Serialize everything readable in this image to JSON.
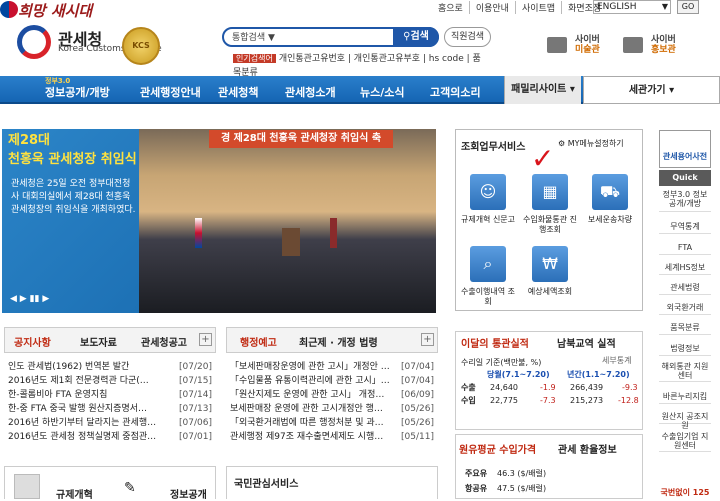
{
  "header": {
    "slogan": "희망 새시대",
    "brand_name": "관세청",
    "brand_sub": "Korea Customs Service",
    "badge": "KCS",
    "top_links": [
      "홈으로",
      "이용안내",
      "사이트맵",
      "화면조정"
    ],
    "language": "ENGLISH",
    "go": "GO",
    "search_scope": "통합검색",
    "search_button": "검색",
    "staff_search": "직원검색",
    "hot_keyword_tag": "인기검색어",
    "hot_keywords": "개인통관고유번호 | 개인통관고유부호 | hs code | 품목분류",
    "cyber1_top": "사이버",
    "cyber1_bottom": "미술관",
    "cyber2_top": "사이버",
    "cyber2_bottom": "홍보관"
  },
  "nav": {
    "gov30": "정부3.0",
    "items": [
      "정보공개/개방",
      "관세행정안내",
      "관세청책",
      "관세청소개",
      "뉴스/소식",
      "고객의소리"
    ],
    "family": "패밀리사이트",
    "sitegate": "세관가기"
  },
  "banner": {
    "title_line1": "제28대",
    "title_line2": "천홍욱 관세청장 취임식",
    "desc": "관세청은 25일 오전 정부대전청사 대회의실에서 제28대 천홍욱관세청장의 취임식을 개최하였다.",
    "stage_sign": "경  제28대 천홍욱 관세청장 취임식  축",
    "controls": "◀ ▶ ▮▮ ▶"
  },
  "services": {
    "title": "조회업무서비스",
    "my_menu": "MY메뉴설정하기",
    "items": [
      {
        "label": "규제개혁 신문고",
        "icon": "person-speech-icon"
      },
      {
        "label": "수입화물통관 진행조회",
        "icon": "cargo-icon"
      },
      {
        "label": "보세운송차량",
        "icon": "truck-icon"
      },
      {
        "label": "수출이행내역 조회",
        "icon": "magnifier-icon"
      },
      {
        "label": "예상세액조회",
        "icon": "won-icon"
      }
    ]
  },
  "rail": {
    "dictionary": "관세용어사전",
    "quick_menu": "Quick Menu",
    "links": [
      "정부3.0 정보공개/개방",
      "무역통계",
      "FTA",
      "세계HS정보",
      "관세법령",
      "외국환거래",
      "품목분류",
      "법령정보",
      "해외통관 지원센터",
      "바른누리지킴",
      "원산지 공조지원",
      "수출입기업 지원센터",
      "국번없이 125"
    ]
  },
  "notice": {
    "tabs": [
      "공지사항",
      "보도자료",
      "관세청공고"
    ],
    "rows": [
      {
        "title": "인도 관세법(1962) 번역본 발간",
        "date": "[07/20]"
      },
      {
        "title": "2016년도 제1회 전문경력관 다군(…",
        "date": "[07/15]"
      },
      {
        "title": "한-콜롬비아 FTA 운영지침",
        "date": "[07/14]"
      },
      {
        "title": "한-중 FTA 중국 발행 원산지증명서…",
        "date": "[07/13]"
      },
      {
        "title": "2016년 하반기부터 달라지는 관세행…",
        "date": "[07/06]"
      },
      {
        "title": "2016년도 관세청 정책실명제 중점관…",
        "date": "[07/01]"
      }
    ]
  },
  "admin": {
    "tabs": [
      "행정예고",
      "최근제 · 개정 법령"
    ],
    "rows": [
      {
        "title": "「보세판매장운영에 관한 고시」개정안 …",
        "date": "[07/04]"
      },
      {
        "title": "「수입물품 유통이력관리에 관한 고시」…",
        "date": "[07/04]"
      },
      {
        "title": "「원산지제도 운영에 관한 고시」 개정…",
        "date": "[06/09]"
      },
      {
        "title": "보세판매장 운영에 관한 고시개정안 행…",
        "date": "[05/26]"
      },
      {
        "title": "「외국환거래법에 따른 행정처분 및 과…",
        "date": "[05/26]"
      },
      {
        "title": "관세행정 제97조 재수출면세제도 시행…",
        "date": "[05/11]"
      }
    ]
  },
  "stats": {
    "tabs": [
      "이달의 통관실적",
      "남북교역 실적"
    ],
    "basis": "수리일 기준(백만불, %)",
    "unit_label": "세부통계",
    "col1": "당월(7.1~7.20)",
    "col2": "년간(1.1~7.20)",
    "export_label": "수출",
    "import_label": "수입",
    "export_month": "24,640",
    "export_month_rate": "-1.9",
    "export_year": "266,439",
    "export_year_rate": "-9.3",
    "import_month": "22,775",
    "import_month_rate": "-7.3",
    "import_year": "215,273",
    "import_year_rate": "-12.8"
  },
  "exchange": {
    "tabs": [
      "원유평균 수입가격",
      "관세 환율정보"
    ],
    "line1_label": "주요유",
    "line1_value": "46.3 ($/배럴)",
    "line2_label": "항공유",
    "line2_value": "47.5 ($/배럴)"
  },
  "bottom": {
    "citizen_service": "국민관심서비스",
    "reg_reform": "규제개혁",
    "info_open": "정보공개"
  }
}
